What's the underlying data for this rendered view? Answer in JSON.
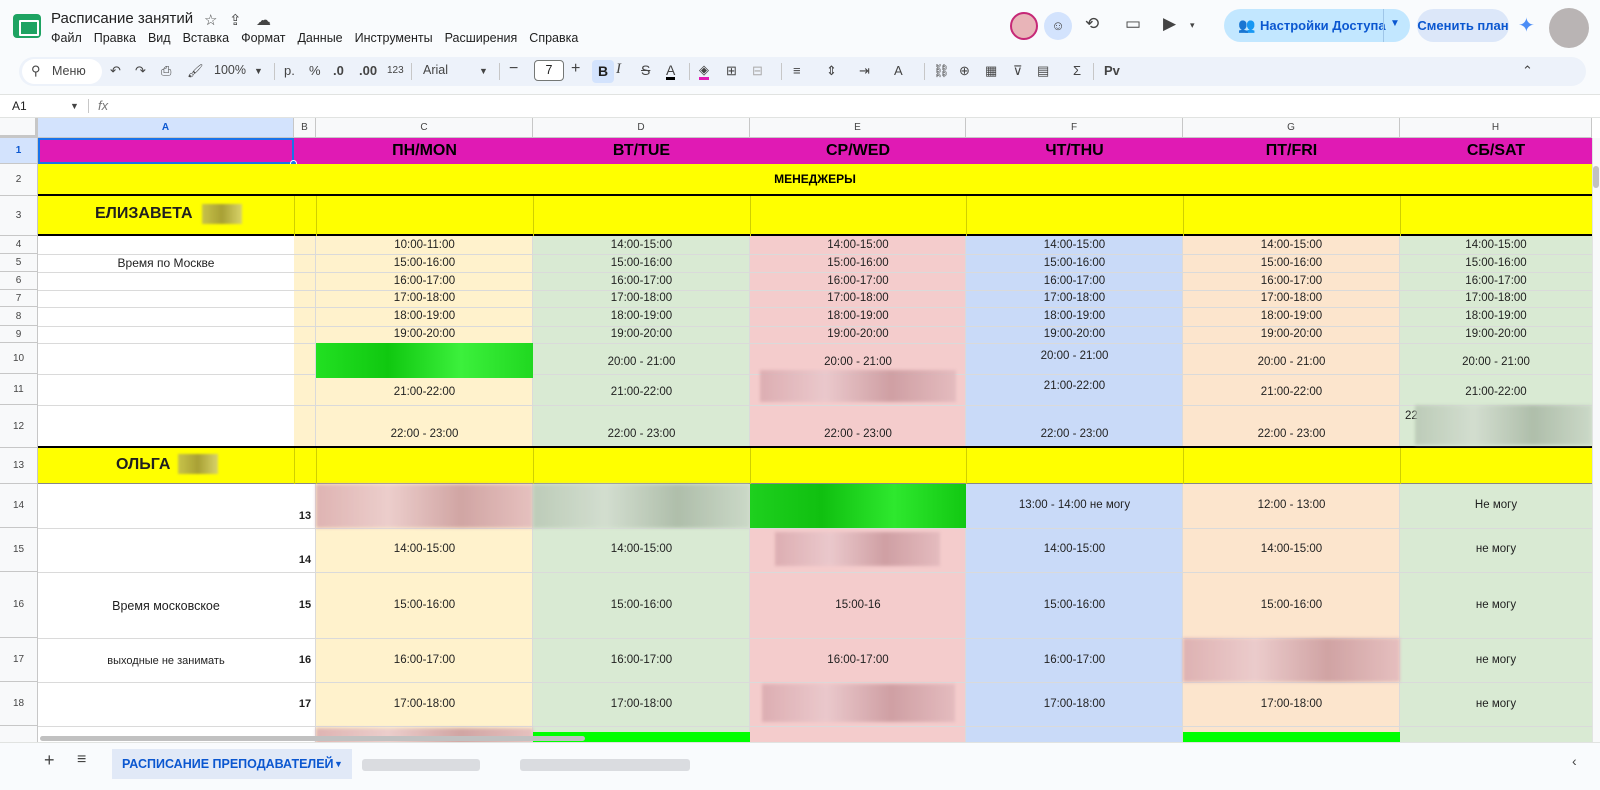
{
  "app": {
    "title": "Расписание занятий",
    "menu": [
      "Файл",
      "Правка",
      "Вид",
      "Вставка",
      "Формат",
      "Данные",
      "Инструменты",
      "Расширения",
      "Справка"
    ],
    "share_label": "Настройки Доступа",
    "plan_label": "Сменить план"
  },
  "toolbar": {
    "search_label": "Меню",
    "zoom": "100%",
    "currency": "р.",
    "percent": "%",
    "dec_minus": ".0",
    "dec_plus": ".00",
    "num_format": "123",
    "font": "Arial",
    "font_size": "7",
    "bold": "B",
    "italic": "I",
    "strike": "S",
    "text_color": "A",
    "functions": "Σ",
    "input_tools": "Рv"
  },
  "formula": {
    "cell": "A1",
    "fx": "fx"
  },
  "columns": [
    "A",
    "B",
    "C",
    "D",
    "E",
    "F",
    "G",
    "H"
  ],
  "rows": [
    "1",
    "2",
    "3",
    "4",
    "5",
    "6",
    "7",
    "8",
    "9",
    "10",
    "11",
    "12",
    "13",
    "14",
    "15",
    "16",
    "17",
    "18"
  ],
  "header": {
    "mon": "ПН/MON",
    "tue": "ВТ/TUE",
    "wed": "СР/WED",
    "thu": "ЧТ/THU",
    "fri": "ПТ/FRI",
    "sat": "СБ/SAT"
  },
  "managers": "МЕНЕДЖЕРЫ",
  "elizaveta": {
    "name": "ЕЛИЗАВЕТА",
    "note": "Время по Москве",
    "times": [
      "10:00-11:00",
      "14:00-15:00",
      "15:00-16:00",
      "16:00-17:00",
      "17:00-18:00",
      "18:00-19:00",
      "19:00-20:00"
    ],
    "t2000": "20:00 - 21:00",
    "t2100": "21:00-22:00",
    "t2200": "22:00 - 23:00",
    "sat_partial": "22"
  },
  "olga": {
    "name": "ОЛЬГА",
    "note1": "Время московское",
    "note2": "выходные не занимать",
    "b_nums": [
      "13",
      "14",
      "15",
      "16",
      "17"
    ],
    "thu14": "13:00 - 14:00 не могу",
    "fri14": "12:00 - 13:00",
    "sat14": "Не могу",
    "t1415": "14:00-15:00",
    "t1516": "15:00-16:00",
    "wed16": "15:00-16",
    "t1617": "16:00-17:00",
    "t1718": "17:00-18:00",
    "cant": "не могу"
  },
  "sheet_tab": "РАСПИСАНИЕ ПРЕПОДАВАТЕЛЕЙ",
  "colors": {
    "magenta": "#e01ab4",
    "yellow": "#ffff00",
    "c_mon": "#fff2cc",
    "c_tue": "#d9ead3",
    "c_wed": "#f4cccc",
    "c_thu": "#c9daf8",
    "c_fri": "#fce5cd",
    "green": "#00ff00"
  }
}
